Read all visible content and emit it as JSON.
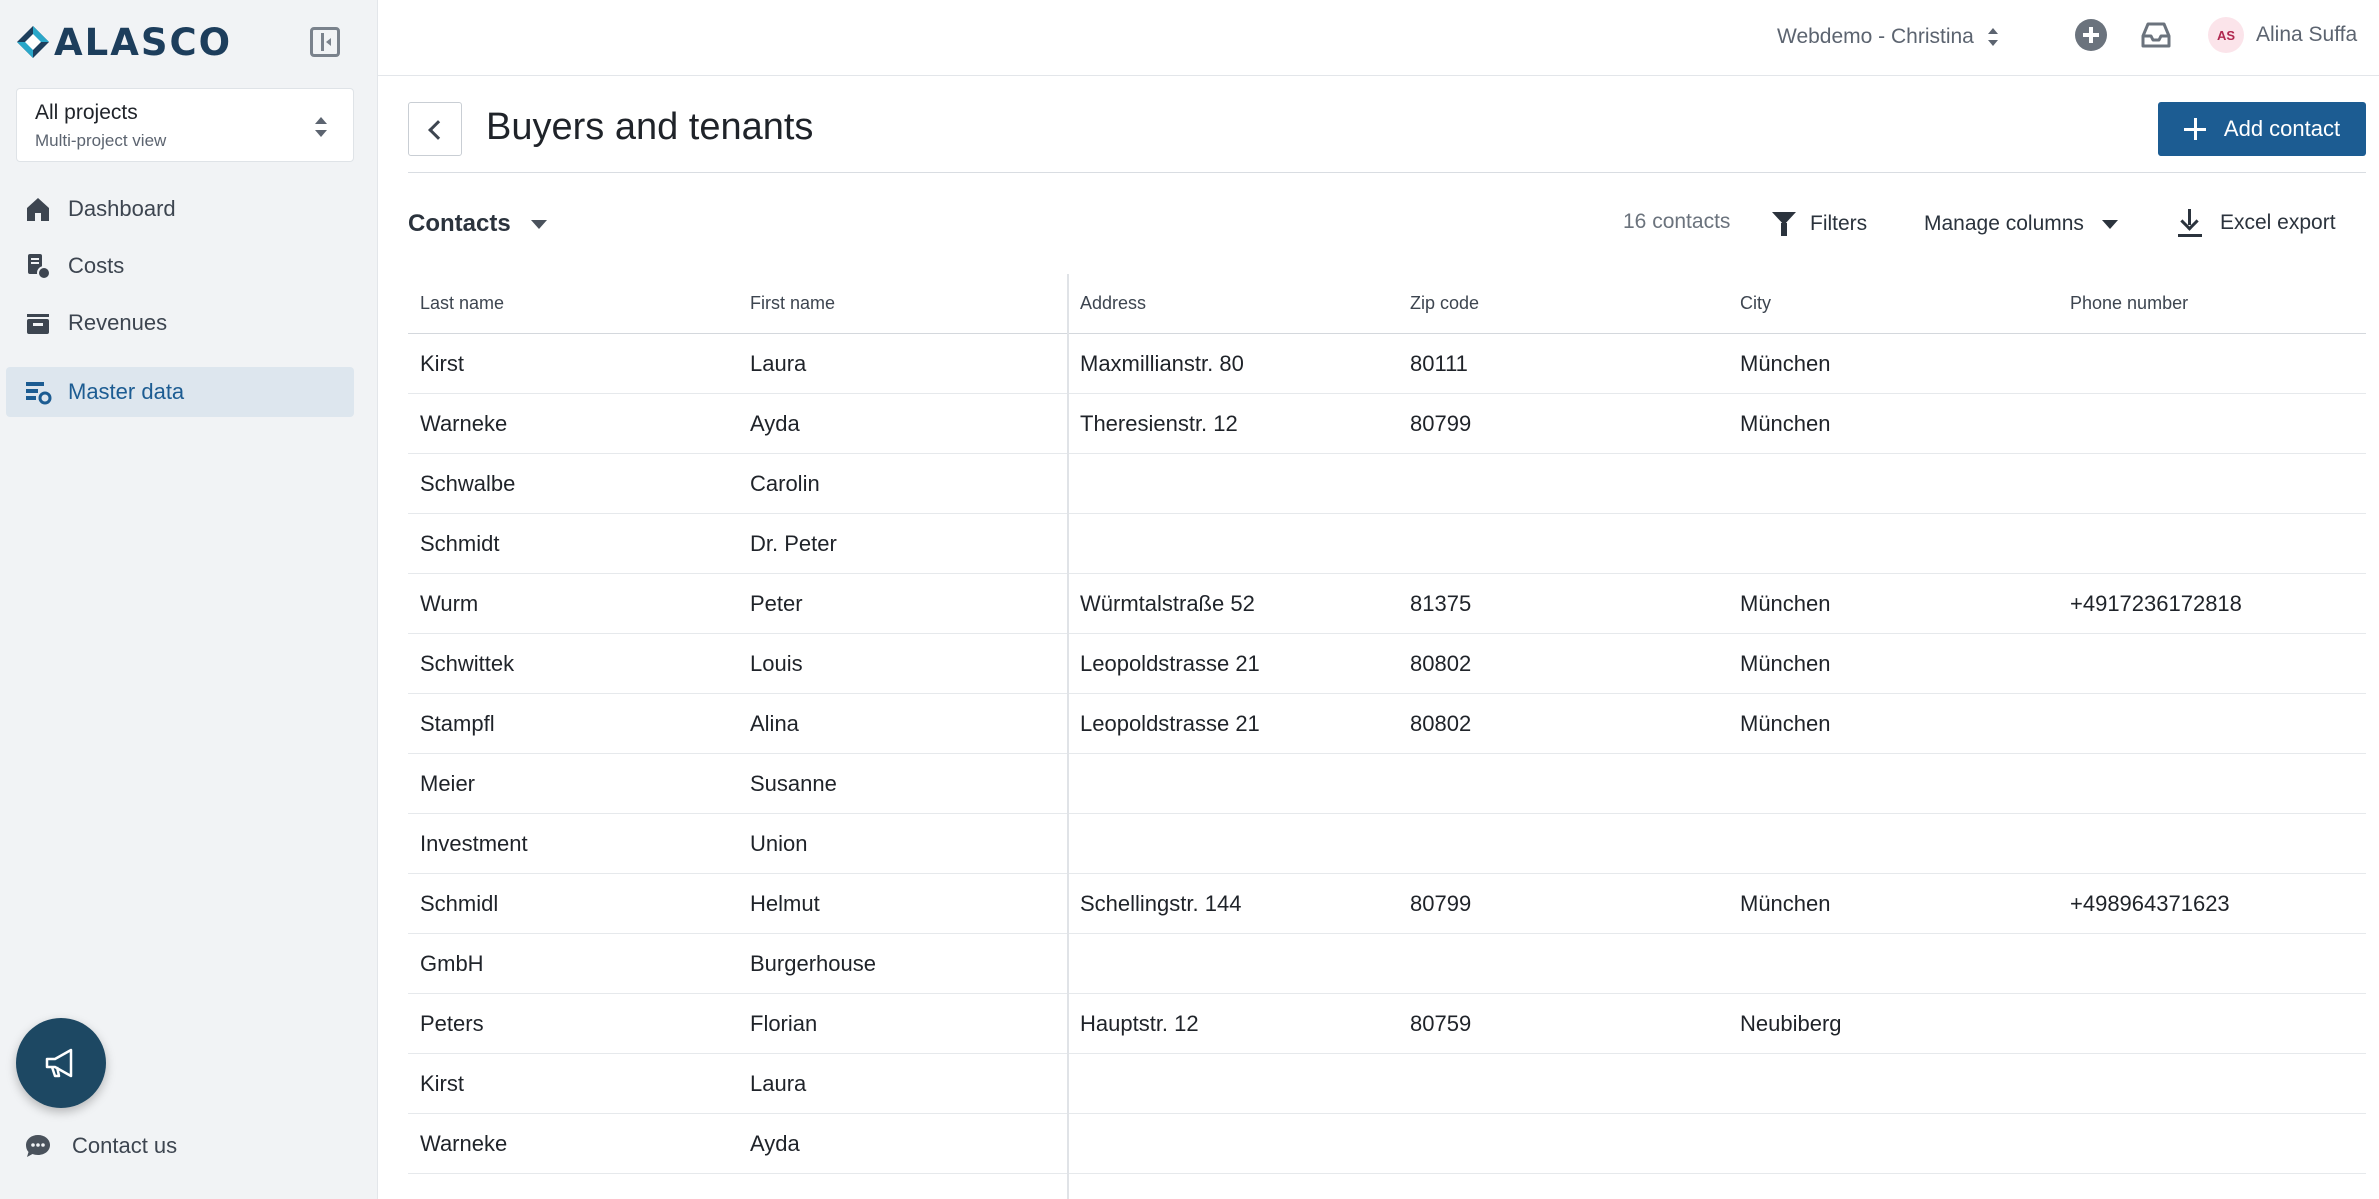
{
  "brand": {
    "name": "ALASCO"
  },
  "project_select": {
    "title": "All projects",
    "subtitle": "Multi-project view"
  },
  "nav": [
    {
      "label": "Dashboard",
      "icon": "home-icon",
      "active": false
    },
    {
      "label": "Costs",
      "icon": "costs-icon",
      "active": false
    },
    {
      "label": "Revenues",
      "icon": "revenues-icon",
      "active": false
    },
    {
      "label": "Master data",
      "icon": "master-data-icon",
      "active": true
    }
  ],
  "contact_us": {
    "label": "Contact us"
  },
  "topbar": {
    "workspace": "Webdemo - Christina",
    "user_initials": "AS",
    "user_name": "Alina Suffa"
  },
  "page": {
    "title": "Buyers and tenants",
    "add_button": "Add contact"
  },
  "toolbar": {
    "view": "Contacts",
    "count": "16 contacts",
    "filters": "Filters",
    "manage_columns": "Manage columns",
    "export": "Excel export"
  },
  "table": {
    "columns": [
      "Last name",
      "First name",
      "Address",
      "Zip code",
      "City",
      "Phone number"
    ],
    "rows": [
      [
        "Kirst",
        "Laura",
        "Maxmillianstr. 80",
        "80111",
        "München",
        ""
      ],
      [
        "Warneke",
        "Ayda",
        "Theresienstr. 12",
        "80799",
        "München",
        ""
      ],
      [
        "Schwalbe",
        "Carolin",
        "",
        "",
        "",
        ""
      ],
      [
        "Schmidt",
        "Dr. Peter",
        "",
        "",
        "",
        ""
      ],
      [
        "Wurm",
        "Peter",
        "Würmtalstraße 52",
        "81375",
        "München",
        "+4917236172818"
      ],
      [
        "Schwittek",
        "Louis",
        "Leopoldstrasse 21",
        "80802",
        "München",
        ""
      ],
      [
        "Stampfl",
        "Alina",
        "Leopoldstrasse 21",
        "80802",
        "München",
        ""
      ],
      [
        "Meier",
        "Susanne",
        "",
        "",
        "",
        ""
      ],
      [
        "Investment",
        "Union",
        "",
        "",
        "",
        ""
      ],
      [
        "Schmidl",
        "Helmut",
        "Schellingstr. 144",
        "80799",
        "München",
        "+498964371623"
      ],
      [
        "GmbH",
        "Burgerhouse",
        "",
        "",
        "",
        ""
      ],
      [
        "Peters",
        "Florian",
        "Hauptstr. 12",
        "80759",
        "Neubiberg",
        ""
      ],
      [
        "Kirst",
        "Laura",
        "",
        "",
        "",
        ""
      ],
      [
        "Warneke",
        "Ayda",
        "",
        "",
        "",
        ""
      ]
    ]
  },
  "colors": {
    "primary": "#1c5c92",
    "sidebar_bg": "#f1f3f5",
    "active_nav_bg": "#dde6ee",
    "megaphone_bg": "#1d4863",
    "avatar_bg": "#fbe4ea"
  }
}
